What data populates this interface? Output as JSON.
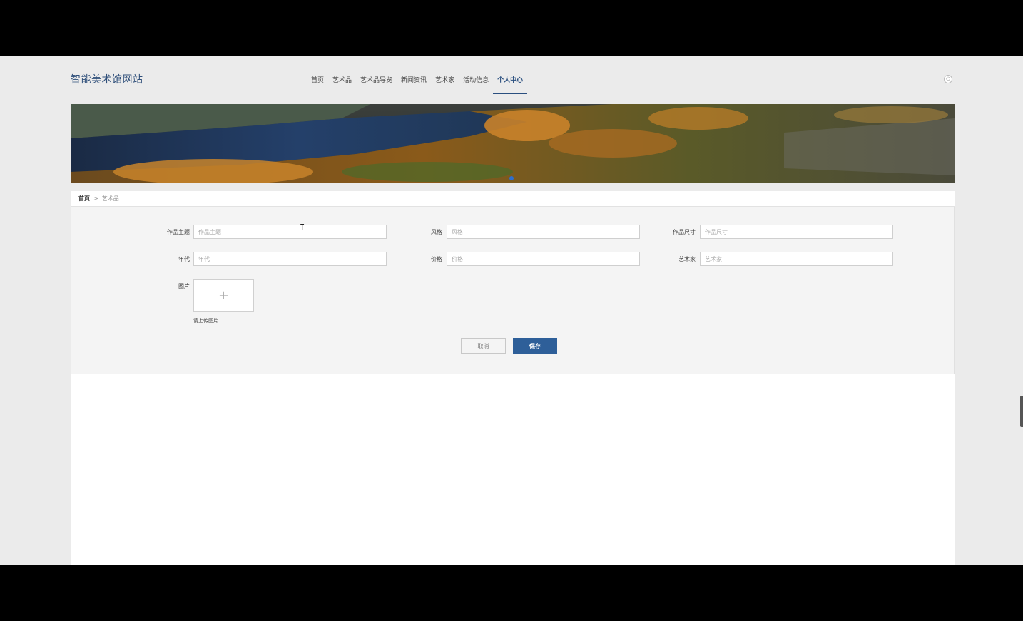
{
  "header": {
    "site_title": "智能美术馆网站",
    "nav": [
      {
        "label": "首页",
        "active": false
      },
      {
        "label": "艺术品",
        "active": false
      },
      {
        "label": "艺术品导览",
        "active": false
      },
      {
        "label": "新闻资讯",
        "active": false
      },
      {
        "label": "艺术家",
        "active": false
      },
      {
        "label": "活动信息",
        "active": false
      },
      {
        "label": "个人中心",
        "active": true
      }
    ],
    "logout_icon": "power-icon"
  },
  "breadcrumb": {
    "home": "首页",
    "separator": ">",
    "current": "艺术品"
  },
  "form": {
    "fields": [
      {
        "label": "作品主题",
        "placeholder": "作品主题",
        "value": ""
      },
      {
        "label": "风格",
        "placeholder": "风格",
        "value": ""
      },
      {
        "label": "作品尺寸",
        "placeholder": "作品尺寸",
        "value": ""
      },
      {
        "label": "年代",
        "placeholder": "年代",
        "value": ""
      },
      {
        "label": "价格",
        "placeholder": "价格",
        "value": ""
      },
      {
        "label": "艺术家",
        "placeholder": "艺术家",
        "value": ""
      }
    ],
    "image_label": "图片",
    "upload_icon": "+",
    "upload_hint": "请上传图片",
    "cancel_label": "取消",
    "save_label": "保存"
  },
  "colors": {
    "accent": "#2e5f99",
    "title": "#2f4f7a",
    "page_bg": "#ebebeb"
  }
}
